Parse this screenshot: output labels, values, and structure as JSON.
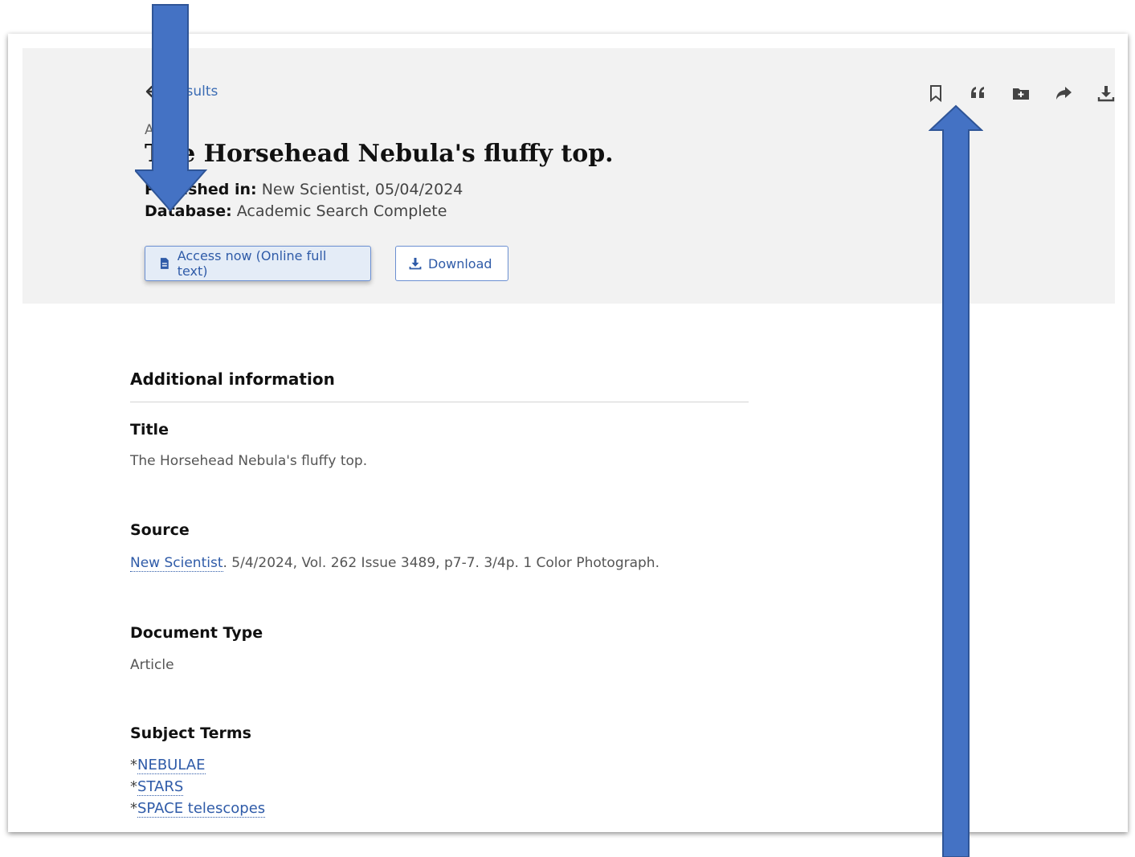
{
  "back_link": {
    "label": "Results"
  },
  "toolbar": {
    "icons": [
      "bookmark-icon",
      "quote-icon",
      "add-folder-icon",
      "share-icon",
      "download-icon"
    ]
  },
  "article": {
    "type_label": "Article",
    "title": "The Horsehead Nebula's fluffy top.",
    "published_label": "Published in:",
    "published_value": "New Scientist, 05/04/2024",
    "database_label": "Database:",
    "database_value": "Academic Search Complete"
  },
  "buttons": {
    "access_now": "Access now (Online full text)",
    "download": "Download"
  },
  "additional_info": {
    "heading": "Additional information",
    "title_label": "Title",
    "title_value": "The Horsehead Nebula's fluffy top.",
    "source_label": "Source",
    "source_link": "New Scientist",
    "source_rest": ". 5/4/2024, Vol. 262 Issue 3489, p7-7. 3/4p. 1 Color Photograph.",
    "doctype_label": "Document Type",
    "doctype_value": "Article",
    "subjects_label": "Subject Terms",
    "subject_prefix": "*",
    "subjects": [
      "NEBULAE",
      "STARS",
      "SPACE telescopes"
    ]
  },
  "colors": {
    "accent": "#2f5ba8",
    "annotation_arrow": "#4472c4",
    "header_band": "#f2f2f2"
  }
}
